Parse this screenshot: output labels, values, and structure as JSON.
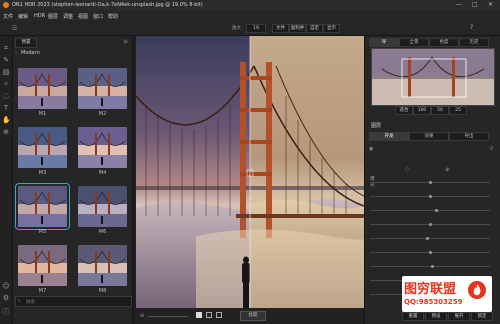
{
  "app": {
    "title": "ON1 HDR 2023 (stephen-leonardi-Oa,k-7eN4ek-unsplash.jpg @ 19.0% 8-bit)",
    "window_controls": [
      "—",
      "□",
      "✕"
    ]
  },
  "menu": [
    "文件",
    "编辑",
    "HDR",
    "图层",
    "调整",
    "视图",
    "窗口",
    "帮助"
  ],
  "toolbar": {
    "zoom_label": "放大",
    "zoom_value": "19",
    "view_buttons": [
      "文件",
      "复制并",
      "自定",
      "显示"
    ],
    "right_buttons": [
      "显示",
      "100",
      "50",
      "25"
    ]
  },
  "presets": {
    "tab_label": "预置",
    "category": "Modern",
    "items": [
      "M1",
      "M2",
      "M3",
      "M4",
      "M5",
      "M6",
      "M7",
      "M8"
    ],
    "selected": "M5",
    "search_placeholder": "搜索"
  },
  "canvas": {
    "compare_label": "比较"
  },
  "navigator": {
    "tabs": [
      "导",
      "全景",
      "色度",
      "历史"
    ],
    "zoom_options": [
      "适合",
      "100",
      "50",
      "25"
    ]
  },
  "adjust": {
    "section_label": "图层",
    "tabs": [
      "开发",
      "效果",
      "导出"
    ],
    "sliders": [
      {
        "label": "曝光",
        "value": 0.5
      },
      {
        "label": "",
        "value": 0.5
      },
      {
        "label": "",
        "value": 0.55
      },
      {
        "label": "",
        "value": 0.5
      },
      {
        "label": "",
        "value": 0.48
      },
      {
        "label": "",
        "value": 0.5
      },
      {
        "label": "",
        "value": 0.52
      },
      {
        "label": "",
        "value": 0.5
      },
      {
        "label": "",
        "value": 0.5
      }
    ],
    "buttons": [
      "重置",
      "预设",
      "展开",
      "锁定"
    ]
  },
  "watermark": {
    "title": "图穷联盟",
    "qq": "QQ:985303259"
  },
  "colors": {
    "accent": "#3aa7c9",
    "watermark_red": "#e8341c"
  }
}
